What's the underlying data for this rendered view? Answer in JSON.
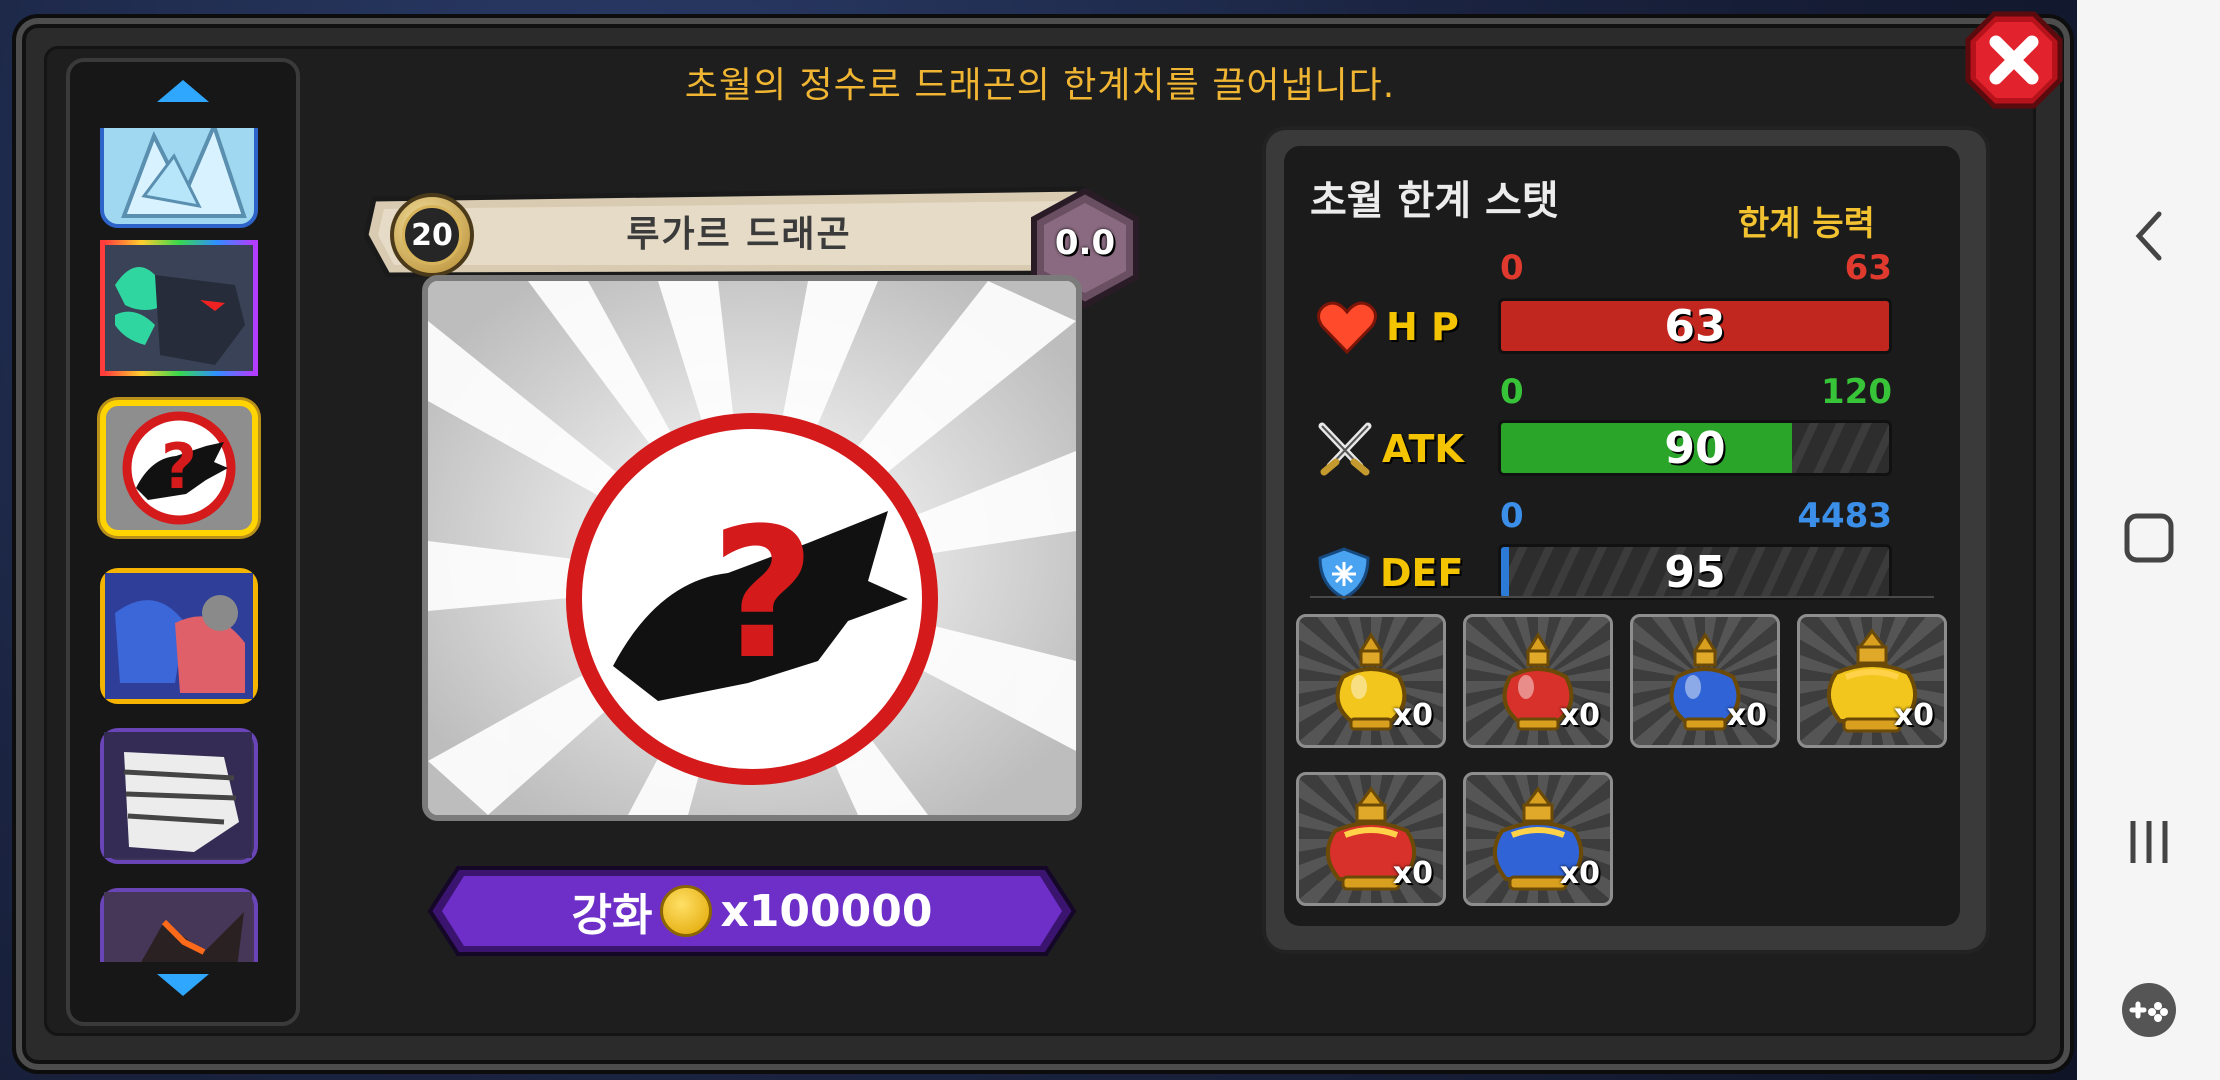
{
  "dialog": {
    "title": "초월의 정수로 드래곤의 한계치를 끌어냅니다."
  },
  "dragon": {
    "name": "루가르 드래곤",
    "level": "20",
    "rating": "0.0"
  },
  "enhance": {
    "label": "강화",
    "cost": "x100000"
  },
  "stats": {
    "title": "초월 한계 스탯",
    "subtitle": "한계 능력",
    "hp": {
      "label": "H P",
      "min": "0",
      "max": "63",
      "value": "63",
      "fraction": 1.0,
      "color": "#c1271f",
      "range_color": "#e03a2f"
    },
    "atk": {
      "label": "ATK",
      "min": "0",
      "max": "120",
      "value": "90",
      "fraction": 0.75,
      "color": "#2aa52a",
      "range_color": "#38c438"
    },
    "def": {
      "label": "DEF",
      "min": "0",
      "max": "4483",
      "value": "95",
      "fraction": 0.021,
      "color": "#2a7ad6",
      "range_color": "#3b8fe8"
    }
  },
  "items": [
    {
      "icon": "yellow-potion-icon",
      "count": "x0",
      "color": "#f2c61c"
    },
    {
      "icon": "red-potion-icon",
      "count": "x0",
      "color": "#d8302a"
    },
    {
      "icon": "blue-potion-icon",
      "count": "x0",
      "color": "#2f63d6"
    },
    {
      "icon": "large-yellow-potion-icon",
      "count": "x0",
      "color": "#f2c61c"
    },
    {
      "icon": "large-red-potion-icon",
      "count": "x0",
      "color": "#d8302a"
    },
    {
      "icon": "large-blue-potion-icon",
      "count": "x0",
      "color": "#2f63d6"
    }
  ]
}
